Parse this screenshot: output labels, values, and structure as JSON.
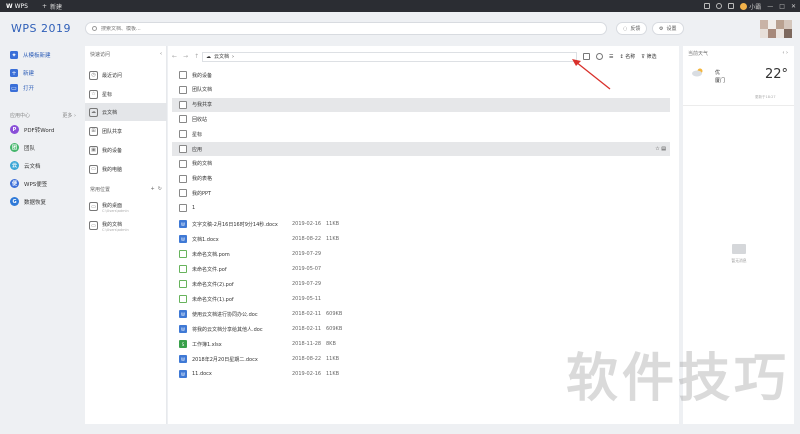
{
  "titlebar": {
    "brand": "WPS",
    "new_tab": "新建",
    "user": "小霸"
  },
  "sidebar": {
    "app_title": "WPS 2019",
    "items": [
      {
        "icon": "template-icon",
        "label": "从模板新建"
      },
      {
        "icon": "new-file-icon",
        "label": "新建"
      },
      {
        "icon": "open-folder-icon",
        "label": "打开"
      }
    ],
    "apps_title": "应用中心",
    "apps_more": "更多 ›",
    "apps": [
      {
        "icon": "pdf-word-icon",
        "label": "PDF转Word",
        "color": "#8a4fd8",
        "glyph": "P"
      },
      {
        "icon": "team-icon",
        "label": "团队",
        "color": "#44b56b",
        "glyph": "团"
      },
      {
        "icon": "cloud-doc-icon",
        "label": "云文档",
        "color": "#3aa6d6",
        "glyph": "云"
      },
      {
        "icon": "wps-note-icon",
        "label": "WPS便签",
        "color": "#3c6fd8",
        "glyph": "便"
      },
      {
        "icon": "data-recovery-icon",
        "label": "数据恢复",
        "color": "#2f7ad8",
        "glyph": "G"
      }
    ]
  },
  "search": {
    "placeholder": "搜索文档、模板..."
  },
  "header": {
    "feedback": "反馈",
    "settings": "设置"
  },
  "quick": {
    "title": "快速访问",
    "items": [
      {
        "icon": "recent-icon",
        "label": "最近访问"
      },
      {
        "icon": "star-icon",
        "label": "星标"
      },
      {
        "icon": "cloud-icon",
        "label": "云文档"
      },
      {
        "icon": "team-share-icon",
        "label": "团队共享"
      },
      {
        "icon": "device-icon",
        "label": "我的设备"
      },
      {
        "icon": "computer-icon",
        "label": "我的电脑"
      }
    ],
    "locations_title": "常用位置",
    "locations": [
      {
        "name": "我的桌面",
        "path": "C:\\Users\\admin"
      },
      {
        "name": "我的文档",
        "path": "C:\\Users\\admin"
      }
    ]
  },
  "path": {
    "current": "云文档",
    "sort": "名称",
    "filter": "筛选"
  },
  "folders": [
    {
      "name": "我的设备",
      "icon": "device-icon"
    },
    {
      "name": "团队文档",
      "icon": "team-doc-icon"
    },
    {
      "name": "与我共享",
      "icon": "share-icon"
    },
    {
      "name": "回收站",
      "icon": "recycle-icon"
    },
    {
      "name": "星标",
      "icon": "star-folder-icon"
    },
    {
      "name": "应用",
      "icon": "app-folder-icon"
    },
    {
      "name": "我的文档",
      "icon": "folder-icon"
    },
    {
      "name": "我的表格",
      "icon": "folder-icon"
    },
    {
      "name": "我的PPT",
      "icon": "folder-icon"
    },
    {
      "name": "1",
      "icon": "folder-icon"
    }
  ],
  "files": [
    {
      "name": "文字文稿-2月16日16时9分14秒.docx",
      "date": "2019-02-16",
      "size": "11KB",
      "type": "doc"
    },
    {
      "name": "文档1.docx",
      "date": "2018-08-22",
      "size": "11KB",
      "type": "doc"
    },
    {
      "name": "未命名文档.pom",
      "date": "2019-07-29",
      "size": "",
      "type": "pdf"
    },
    {
      "name": "未命名文件.pof",
      "date": "2019-05-07",
      "size": "",
      "type": "pdf"
    },
    {
      "name": "未命名文件(2).pof",
      "date": "2019-07-29",
      "size": "",
      "type": "pdf"
    },
    {
      "name": "未命名文件(1).pof",
      "date": "2019-05-11",
      "size": "",
      "type": "pdf"
    },
    {
      "name": "使用云文档进行协同办公.doc",
      "date": "2018-02-11",
      "size": "609KB",
      "type": "doc"
    },
    {
      "name": "将我的云文档分享给其他人.doc",
      "date": "2018-02-11",
      "size": "609KB",
      "type": "doc"
    },
    {
      "name": "工作簿1.xlsx",
      "date": "2018-11-28",
      "size": "8KB",
      "type": "xls"
    },
    {
      "name": "2018年2月20日星期二.docx",
      "date": "2018-08-22",
      "size": "11KB",
      "type": "doc"
    },
    {
      "name": "11.docx",
      "date": "2019-02-16",
      "size": "11KB",
      "type": "doc"
    }
  ],
  "weather": {
    "title": "当前天气",
    "condition": "优",
    "city": "厦门",
    "temp": "22°",
    "updated": "更新于18:27"
  },
  "empty": {
    "text": "暂无消息"
  },
  "watermark": "软件技巧"
}
